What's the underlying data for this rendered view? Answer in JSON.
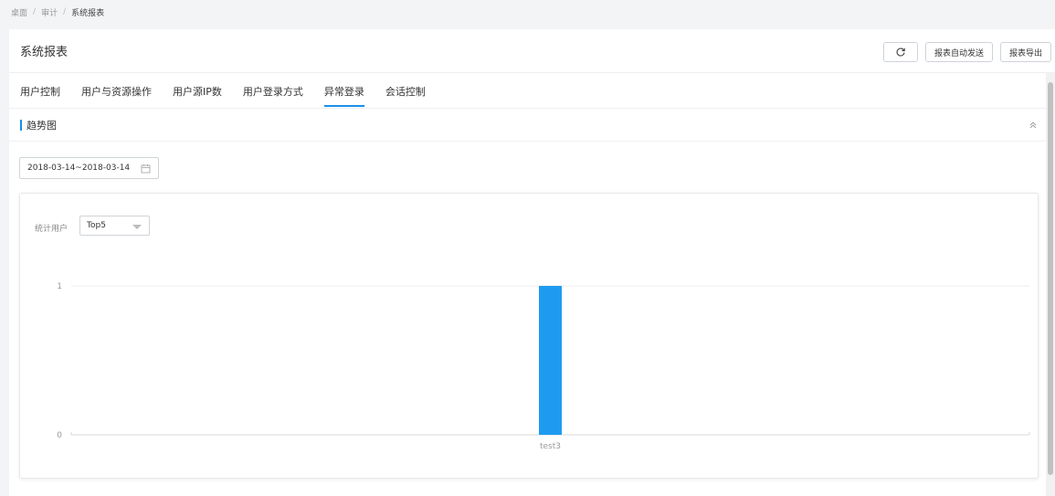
{
  "breadcrumb": {
    "items": [
      "桌面",
      "审计",
      "系统报表"
    ],
    "separator": "/"
  },
  "header": {
    "title": "系统报表",
    "actions": {
      "refresh_icon": "refresh-icon",
      "auto_send": "报表自动发送",
      "export": "报表导出"
    }
  },
  "tabs": [
    {
      "label": "用户控制",
      "active": false
    },
    {
      "label": "用户与资源操作",
      "active": false
    },
    {
      "label": "用户源IP数",
      "active": false
    },
    {
      "label": "用户登录方式",
      "active": false
    },
    {
      "label": "异常登录",
      "active": true
    },
    {
      "label": "会话控制",
      "active": false
    }
  ],
  "section": {
    "title": "趋势图",
    "collapse_icon": "double-chevron-up-icon"
  },
  "filter": {
    "date_range": "2018-03-14~2018-03-14",
    "calendar_icon": "calendar-icon"
  },
  "chart_panel": {
    "stat_label": "统计用户",
    "select_value": "Top5"
  },
  "colors": {
    "accent": "#1a8fe8",
    "bar": "#1e9bf0"
  },
  "chart_data": {
    "type": "bar",
    "categories": [
      "test3"
    ],
    "values": [
      1
    ],
    "title": "",
    "xlabel": "",
    "ylabel": "",
    "ylim": [
      0,
      1
    ],
    "yticks": [
      0,
      1
    ],
    "grid": true
  }
}
